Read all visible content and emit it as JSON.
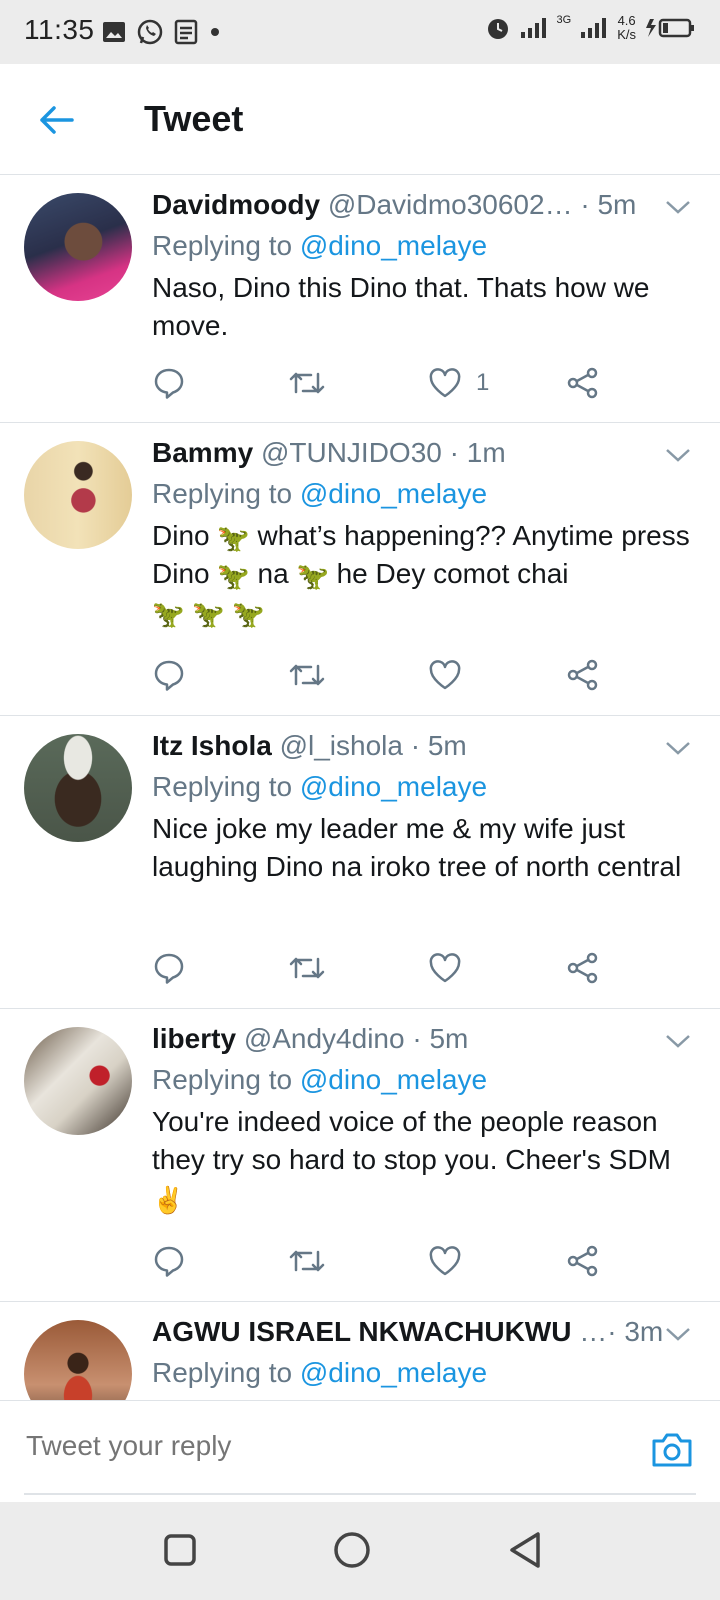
{
  "status_bar": {
    "time": "11:35",
    "network": "3G",
    "speed_value": "4.6",
    "speed_unit": "K/s"
  },
  "header": {
    "title": "Tweet"
  },
  "tweets": [
    {
      "name": "Davidmoody",
      "handle": "@Davidmo30602…",
      "time": "· 5m",
      "replying_prefix": "Replying to ",
      "replying_to": "@dino_melaye",
      "text": "Naso, Dino this Dino that. Thats how we move.",
      "like_count": "1"
    },
    {
      "name": "Bammy",
      "handle": "@TUNJIDO30",
      "time": "· 1m",
      "replying_prefix": "Replying to ",
      "replying_to": "@dino_melaye",
      "text_parts": [
        "Dino ",
        " what’s happening?? Anytime press Dino ",
        " na ",
        " he Dey comot chai"
      ],
      "emoji": "🦖"
    },
    {
      "name": "Itz Ishola",
      "handle": "@l_ishola",
      "time": "· 5m",
      "replying_prefix": "Replying to ",
      "replying_to": "@dino_melaye",
      "text": "Nice joke my leader me & my wife just laughing Dino na iroko tree of  north central"
    },
    {
      "name": "liberty",
      "handle": "@Andy4dino",
      "time": "· 5m",
      "replying_prefix": "Replying to ",
      "replying_to": "@dino_melaye",
      "text": "You're indeed voice of the people reason they try so hard to stop you. Cheer's SDM",
      "emoji": "✌"
    },
    {
      "name": "AGWU ISRAEL NKWACHUKWU",
      "handle": "…",
      "time": "· 3m",
      "replying_prefix": "Replying to ",
      "replying_to": "@dino_melaye"
    }
  ],
  "reply_bar": {
    "placeholder": "Tweet your reply"
  },
  "icons": {
    "back": "arrow-left-icon",
    "caret": "chevron-down-icon",
    "reply": "reply-bubble-icon",
    "retweet": "retweet-icon",
    "like": "heart-icon",
    "share": "share-icon",
    "camera": "camera-icon"
  },
  "colors": {
    "accent": "#1b95e0",
    "text": "#14171a",
    "secondary": "#657786",
    "divider": "#dfe3e7"
  }
}
